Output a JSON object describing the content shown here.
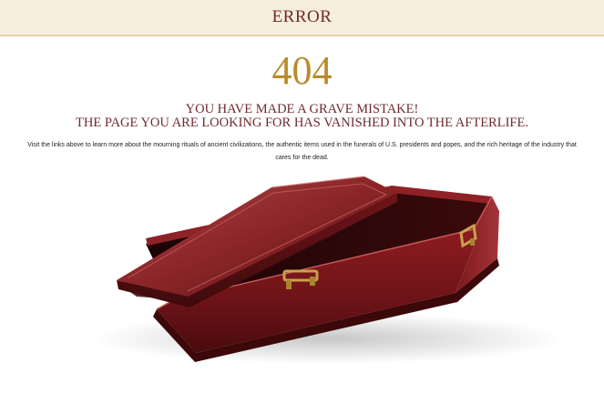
{
  "header": {
    "title": "ERROR"
  },
  "error": {
    "code": "404",
    "headline_line1": "YOU HAVE MADE A GRAVE MISTAKE!",
    "headline_line2": "THE PAGE YOU ARE LOOKING FOR HAS VANISHED INTO THE AFTERLIFE.",
    "description": "Visit the links above to learn more about the mourning rituals of ancient civilizations, the authentic items used in the funerals of U.S. presidents and popes, and the rich heritage of the industry that cares for the dead."
  },
  "colors": {
    "header_background": "#f6eedc",
    "accent_maroon": "#6e2a30",
    "accent_gold": "#b88b2c",
    "coffin_wood": "#7a1418"
  },
  "illustration": {
    "subject": "coffin-icon"
  }
}
